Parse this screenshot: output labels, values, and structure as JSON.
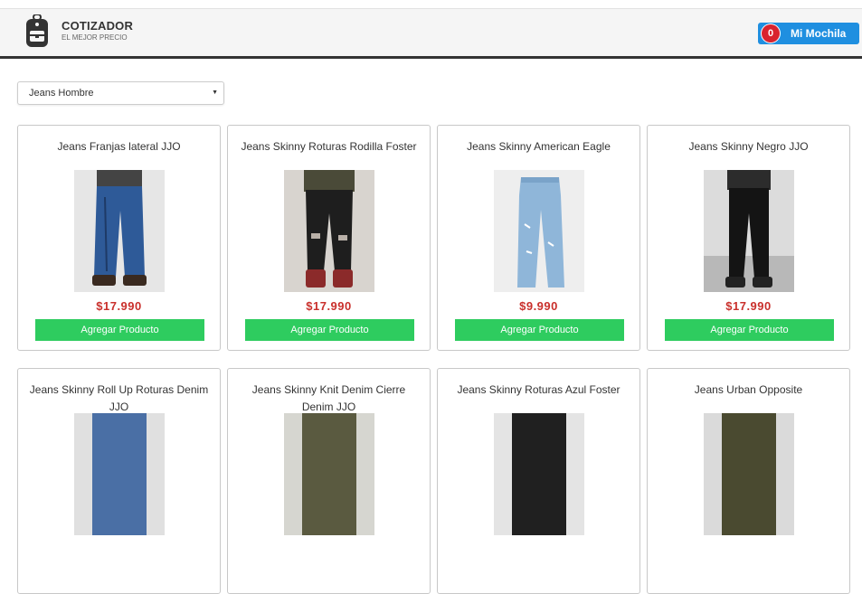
{
  "header": {
    "brand_name": "COTIZADOR",
    "brand_tagline": "EL MEJOR PRECIO",
    "logo_icon": "backpack-icon",
    "cart": {
      "count": "0",
      "label": "Mi Mochila"
    }
  },
  "filter": {
    "selected": "Jeans Hombre"
  },
  "products": [
    {
      "title": "Jeans Franjas lateral JJO",
      "price": "$17.990",
      "button": "Agregar Producto",
      "image": "jeans-dark-blue-model"
    },
    {
      "title": "Jeans Skinny Roturas Rodilla Foster",
      "price": "$17.990",
      "button": "Agregar Producto",
      "image": "jeans-black-ripped-model"
    },
    {
      "title": "Jeans Skinny American Eagle",
      "price": "$9.990",
      "button": "Agregar Producto",
      "image": "jeans-light-blue-flat"
    },
    {
      "title": "Jeans Skinny Negro JJO",
      "price": "$17.990",
      "button": "Agregar Producto",
      "image": "jeans-black-model"
    },
    {
      "title": "Jeans Skinny Roll Up Roturas Denim JJO",
      "price": "",
      "button": "",
      "image": "jeans-blue-model"
    },
    {
      "title": "Jeans Skinny Knit Denim Cierre Denim JJO",
      "price": "",
      "button": "",
      "image": "jeans-camo-model"
    },
    {
      "title": "Jeans Skinny Roturas Azul Foster",
      "price": "",
      "button": "",
      "image": "jeans-dark-model"
    },
    {
      "title": "Jeans Urban Opposite",
      "price": "",
      "button": "",
      "image": "jeans-olive-model"
    }
  ],
  "colors": {
    "primary": "#1f8fe0",
    "badge": "#d9232e",
    "price": "#c9302c",
    "add": "#2ecc5f"
  }
}
